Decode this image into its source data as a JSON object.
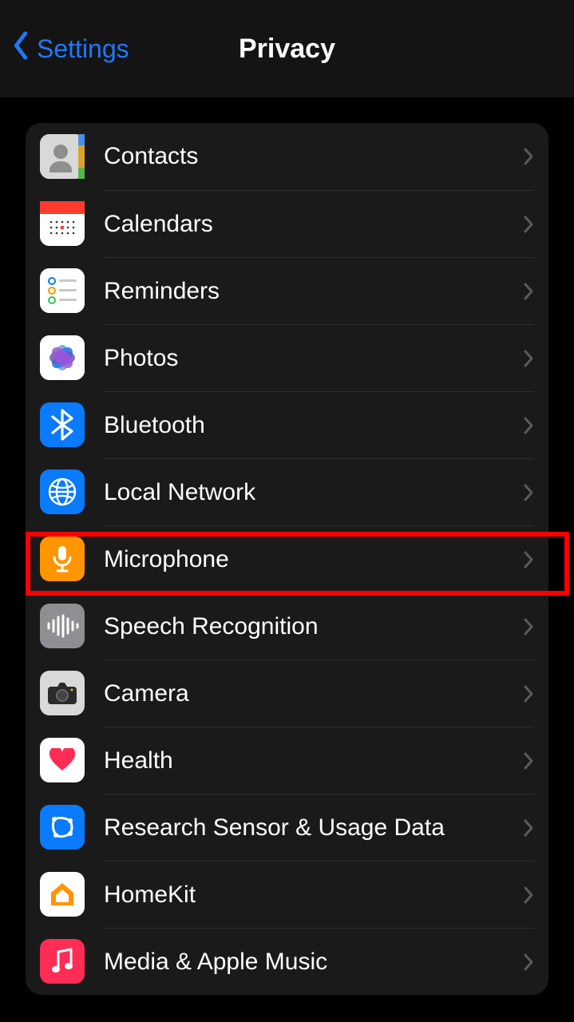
{
  "nav": {
    "back_label": "Settings",
    "title": "Privacy"
  },
  "items": [
    {
      "id": "contacts",
      "label": "Contacts"
    },
    {
      "id": "calendars",
      "label": "Calendars"
    },
    {
      "id": "reminders",
      "label": "Reminders"
    },
    {
      "id": "photos",
      "label": "Photos"
    },
    {
      "id": "bluetooth",
      "label": "Bluetooth"
    },
    {
      "id": "localnet",
      "label": "Local Network"
    },
    {
      "id": "microphone",
      "label": "Microphone",
      "highlighted": true
    },
    {
      "id": "speech",
      "label": "Speech Recognition"
    },
    {
      "id": "camera",
      "label": "Camera"
    },
    {
      "id": "health",
      "label": "Health"
    },
    {
      "id": "research",
      "label": "Research Sensor & Usage Data"
    },
    {
      "id": "homekit",
      "label": "HomeKit"
    },
    {
      "id": "media",
      "label": "Media & Apple Music"
    }
  ],
  "colors": {
    "accent_blue": "#1f79ff",
    "highlight_red": "#ff0000",
    "row_bg": "#1a1a1a"
  }
}
